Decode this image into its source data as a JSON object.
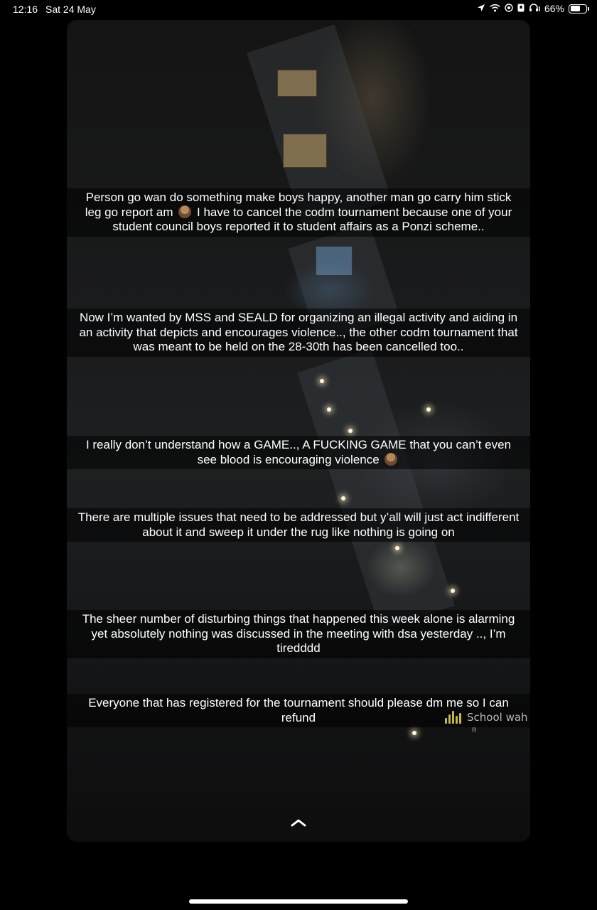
{
  "status_bar": {
    "time": "12:16",
    "date": "Sat 24 May",
    "battery_percent_label": "66%",
    "battery_level": 0.66,
    "icons": [
      "location-arrow-icon",
      "wifi-icon",
      "at-sign-icon",
      "lock-icon",
      "headphones-icon",
      "battery-icon"
    ]
  },
  "story": {
    "captions": [
      {
        "text_before": "Person go wan do something make boys happy, another man go carry him stick leg go report am",
        "text_after": " I have to cancel the codm tournament because one of your student council boys reported it to student affairs as a Ponzi scheme.."
      },
      {
        "text": "Now I’m wanted by MSS and SEALD for organizing an illegal activity and aiding in an activity that depicts and encourages violence.., the other codm tournament that was meant to be held on the 28-30th has been cancelled too.."
      },
      {
        "text_before": "I really don’t understand how a GAME.., A FUCKING GAME that you can’t even see blood is encouraging violence",
        "text_after": ""
      },
      {
        "text": "There are multiple issues that need to be addressed but y’all will just act indifferent about it and sweep it under the rug like nothing is going on"
      },
      {
        "text": "The sheer number of disturbing things that happened this week alone  is alarming yet absolutely nothing was discussed in the meeting with dsa yesterday .., I’m tiredddd"
      },
      {
        "text": "Everyone that has registered for the tournament should please dm me so I can refund"
      }
    ],
    "audio": {
      "title": "School wah",
      "subtitle": "R",
      "accent_color": "#c7b74a"
    }
  }
}
